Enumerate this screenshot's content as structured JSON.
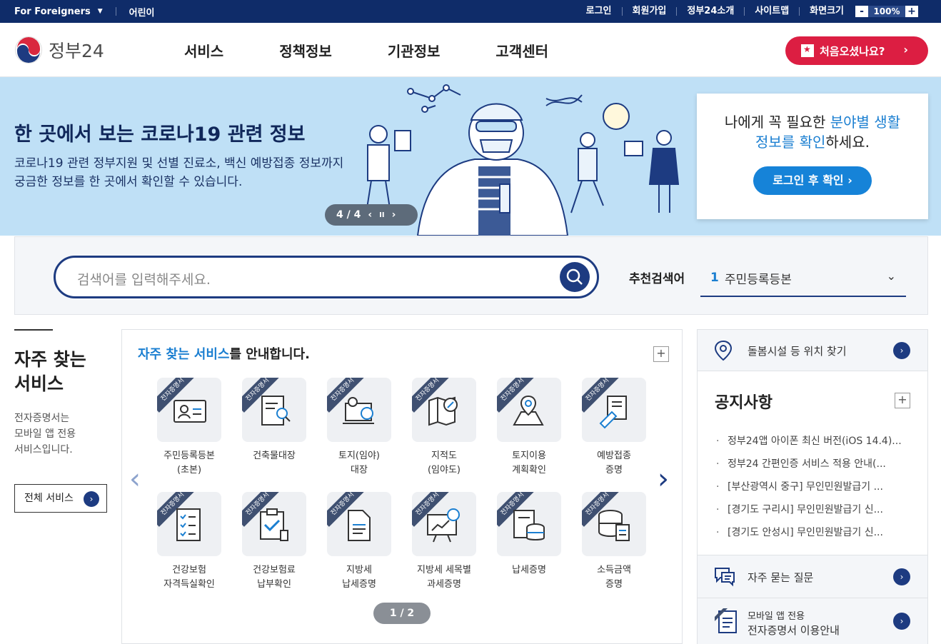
{
  "utility": {
    "lang": "For Foreigners",
    "kids": "어린이",
    "links": [
      "로그인",
      "회원가입",
      "정부24소개",
      "사이트맵"
    ],
    "zoom_label": "화면크기",
    "zoom_minus": "-",
    "zoom_value": "100%",
    "zoom_plus": "+"
  },
  "header": {
    "logo_text": "정부24",
    "nav": [
      "서비스",
      "정책정보",
      "기관정보",
      "고객센터"
    ],
    "first_visit": "처음오셨나요?"
  },
  "banner": {
    "title": "한 곳에서 보는 코로나19 관련 정보",
    "desc_line1": "코로나19 관련 정부지원 및 선별 진료소, 백신 예방접종 정보까지",
    "desc_line2": "궁금한 정보를 한 곳에서 확인할 수 있습니다.",
    "pager": "4 / 4",
    "pager_prev": "‹",
    "pager_pause": "II",
    "pager_next": "›"
  },
  "login_box": {
    "msg_a": "나에게 꼭 필요한 ",
    "msg_hl1": "분야별 생활",
    "msg_hl2": "정보를 확인",
    "msg_b": "하세요.",
    "button": "로그인 후 확인 ›"
  },
  "search": {
    "placeholder": "검색어를 입력해주세요.",
    "rec_label": "추천검색어",
    "rec_num": "1",
    "rec_value": "주민등록등본"
  },
  "left": {
    "title_1": "자주 찾는",
    "title_2": "서비스",
    "desc_1": "전자증명서는",
    "desc_2": "모바일 앱 전용",
    "desc_3": "서비스입니다.",
    "all_button": "전체 서비스"
  },
  "services": {
    "title_hl": "자주 찾는 서비스",
    "title_rest": "를 안내합니다.",
    "ribbon": "전자증명서",
    "pager": "1 / 2",
    "items": [
      {
        "l1": "주민등록등본",
        "l2": "(초본)",
        "icon": "id-card-icon"
      },
      {
        "l1": "건축물대장",
        "l2": "",
        "icon": "document-search-icon"
      },
      {
        "l1": "토지(임야)",
        "l2": "대장",
        "icon": "laptop-location-icon"
      },
      {
        "l1": "지적도",
        "l2": "(임야도)",
        "icon": "map-search-icon"
      },
      {
        "l1": "토지이용",
        "l2": "계획확인",
        "icon": "map-pin-icon"
      },
      {
        "l1": "예방접종",
        "l2": "증명",
        "icon": "syringe-icon"
      },
      {
        "l1": "건강보험",
        "l2": "자격득실확인",
        "icon": "checklist-icon"
      },
      {
        "l1": "건강보험료",
        "l2": "납부확인",
        "icon": "clipboard-check-icon"
      },
      {
        "l1": "지방세",
        "l2": "납세증명",
        "icon": "file-icon"
      },
      {
        "l1": "지방세 세목별",
        "l2": "과세증명",
        "icon": "presentation-chart-icon"
      },
      {
        "l1": "납세증명",
        "l2": "",
        "icon": "coins-document-icon"
      },
      {
        "l1": "소득금액",
        "l2": "증명",
        "icon": "coins-stack-icon"
      }
    ]
  },
  "right": {
    "care": "돌봄시설 등 위치 찾기",
    "notice_title": "공지사항",
    "notices": [
      "정부24앱 아이폰 최신 버전(iOS 14.4)...",
      "정부24 간편인증 서비스 적용 안내(...",
      "[부산광역시 중구] 무인민원발급기 ...",
      "[경기도 구리시] 무인민원발급기 신...",
      "[경기도 안성시] 무인민원발급기 신..."
    ],
    "faq": "자주 묻는 질문",
    "mobile_small": "모바일 앱 전용",
    "mobile_big": "전자증명서 이용안내"
  },
  "colors": {
    "navy": "#0f2c69",
    "accent_blue": "#1b7fd1",
    "red": "#dc1e42",
    "banner_bg": "#bfe0f6"
  }
}
